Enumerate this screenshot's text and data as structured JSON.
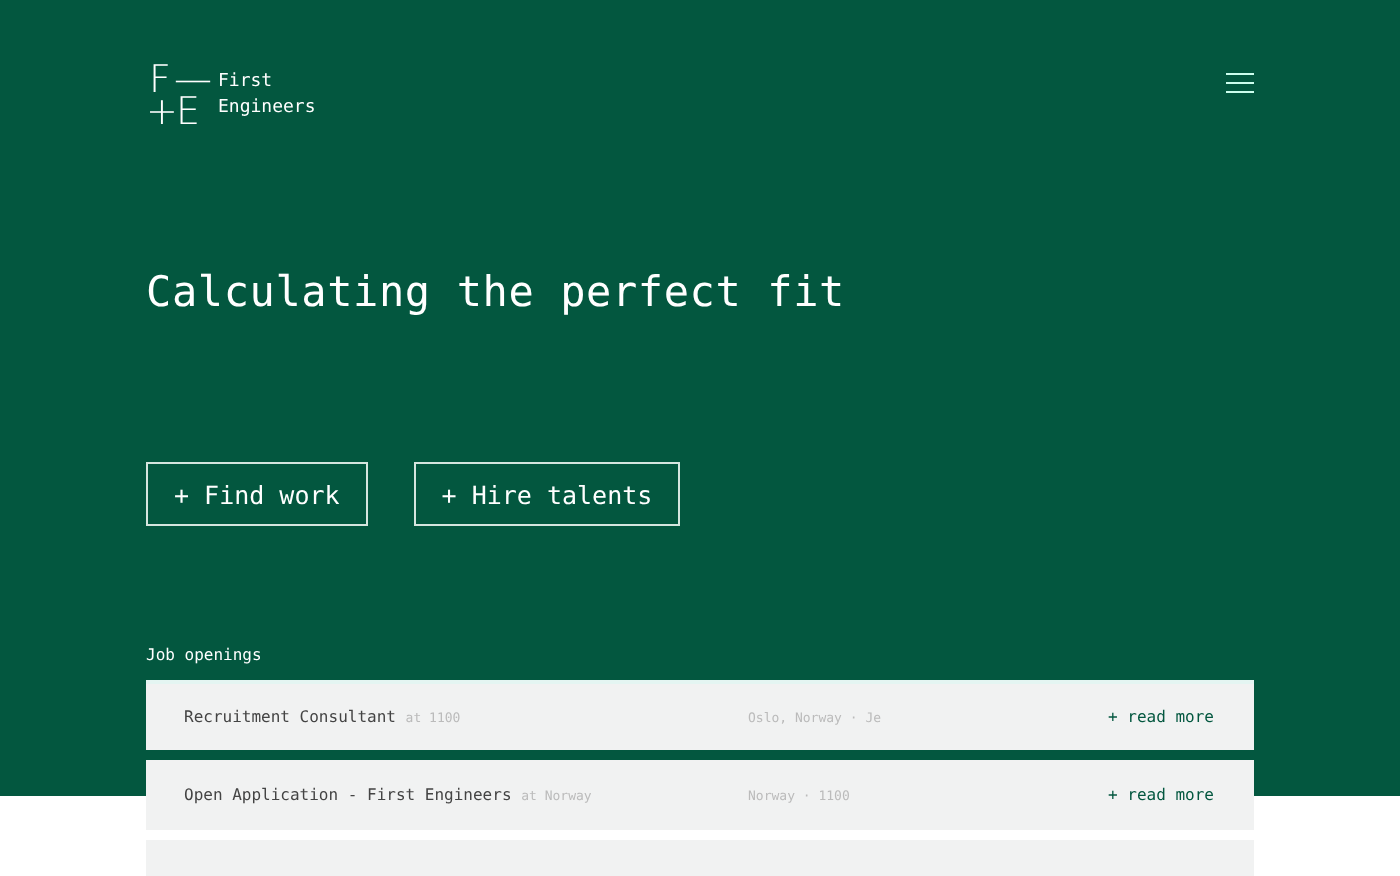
{
  "logo": {
    "marks": [
      "F",
      "—",
      "+",
      "E"
    ],
    "name_lines": [
      "First",
      "Engineers"
    ]
  },
  "headline": "Calculating the perfect fit",
  "buttons": [
    "+ Find work",
    "+ Hire talents"
  ],
  "section_title": "Job openings",
  "jobs": [
    {
      "kind": "job",
      "title": "Recruitment Consultant",
      "company": "at 1100",
      "location": "Oslo, Norway · Je",
      "action": "+ read more"
    },
    {
      "kind": "job",
      "title": "Open Application - First Engineers",
      "company": "at Norway",
      "location": "Norway · 1100",
      "action": "+ read more"
    },
    {
      "kind": "cut"
    }
  ]
}
